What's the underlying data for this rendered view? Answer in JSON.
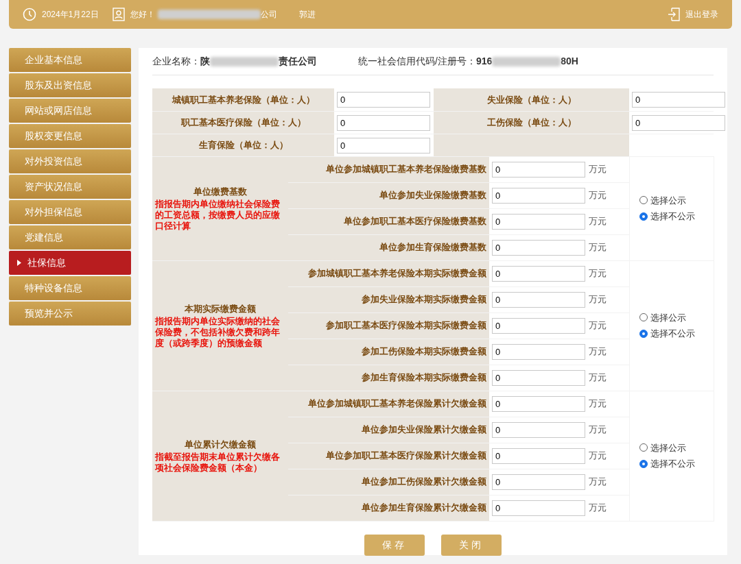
{
  "header": {
    "date": "2024年1月22日",
    "greeting": "您好！",
    "greeting_end": "公司",
    "user": "郭进",
    "logout": "退出登录"
  },
  "sidebar": {
    "items": [
      {
        "label": "企业基本信息",
        "selected": false
      },
      {
        "label": "股东及出资信息",
        "selected": false
      },
      {
        "label": "网站或网店信息",
        "selected": false
      },
      {
        "label": "股权变更信息",
        "selected": false
      },
      {
        "label": "对外投资信息",
        "selected": false
      },
      {
        "label": "资产状况信息",
        "selected": false
      },
      {
        "label": "对外担保信息",
        "selected": false
      },
      {
        "label": "党建信息",
        "selected": false
      },
      {
        "label": "社保信息",
        "selected": true
      },
      {
        "label": "特种设备信息",
        "selected": false
      },
      {
        "label": "预览并公示",
        "selected": false
      }
    ]
  },
  "company": {
    "name_label": "企业名称：",
    "name_start": "陕",
    "name_end": "责任公司",
    "code_label": "统一社会信用代码/注册号：",
    "code_start": "916",
    "code_end": "80H"
  },
  "headcount": [
    {
      "label": "城镇职工基本养老保险（单位：人）",
      "value": "0"
    },
    {
      "label": "失业保险（单位：人）",
      "value": "0"
    },
    {
      "label": "职工基本医疗保险（单位：人）",
      "value": "0"
    },
    {
      "label": "工伤保险（单位：人）",
      "value": "0"
    },
    {
      "label": "生育保险（单位：人）",
      "value": "0"
    }
  ],
  "sections": [
    {
      "title": "单位缴费基数",
      "note": "指报告期内单位缴纳社会保险费的工资总额，按缴费人员的应缴口径计算",
      "fields": [
        {
          "label": "单位参加城镇职工基本养老保险缴费基数",
          "value": "0",
          "unit": "万元"
        },
        {
          "label": "单位参加失业保险缴费基数",
          "value": "0",
          "unit": "万元"
        },
        {
          "label": "单位参加职工基本医疗保险缴费基数",
          "value": "0",
          "unit": "万元"
        },
        {
          "label": "单位参加生育保险缴费基数",
          "value": "0",
          "unit": "万元"
        }
      ],
      "options": [
        {
          "label": "选择公示",
          "selected": false
        },
        {
          "label": "选择不公示",
          "selected": true
        }
      ]
    },
    {
      "title": "本期实际缴费金额",
      "note": "指报告期内单位实际缴纳的社会保险费，不包括补缴欠费和跨年度（或跨季度）的预缴金额",
      "fields": [
        {
          "label": "参加城镇职工基本养老保险本期实际缴费金额",
          "value": "0",
          "unit": "万元"
        },
        {
          "label": "参加失业保险本期实际缴费金额",
          "value": "0",
          "unit": "万元"
        },
        {
          "label": "参加职工基本医疗保险本期实际缴费金额",
          "value": "0",
          "unit": "万元"
        },
        {
          "label": "参加工伤保险本期实际缴费金额",
          "value": "0",
          "unit": "万元"
        },
        {
          "label": "参加生育保险本期实际缴费金额",
          "value": "0",
          "unit": "万元"
        }
      ],
      "options": [
        {
          "label": "选择公示",
          "selected": false
        },
        {
          "label": "选择不公示",
          "selected": true
        }
      ]
    },
    {
      "title": "单位累计欠缴金额",
      "note": "指截至报告期末单位累计欠缴各项社会保险费金额（本金）",
      "fields": [
        {
          "label": "单位参加城镇职工基本养老保险累计欠缴金额",
          "value": "0",
          "unit": "万元"
        },
        {
          "label": "单位参加失业保险累计欠缴金额",
          "value": "0",
          "unit": "万元"
        },
        {
          "label": "单位参加职工基本医疗保险累计欠缴金额",
          "value": "0",
          "unit": "万元"
        },
        {
          "label": "单位参加工伤保险累计欠缴金额",
          "value": "0",
          "unit": "万元"
        },
        {
          "label": "单位参加生育保险累计欠缴金额",
          "value": "0",
          "unit": "万元"
        }
      ],
      "options": [
        {
          "label": "选择公示",
          "selected": false
        },
        {
          "label": "选择不公示",
          "selected": true
        }
      ]
    }
  ],
  "buttons": [
    "保存",
    "关闭"
  ]
}
